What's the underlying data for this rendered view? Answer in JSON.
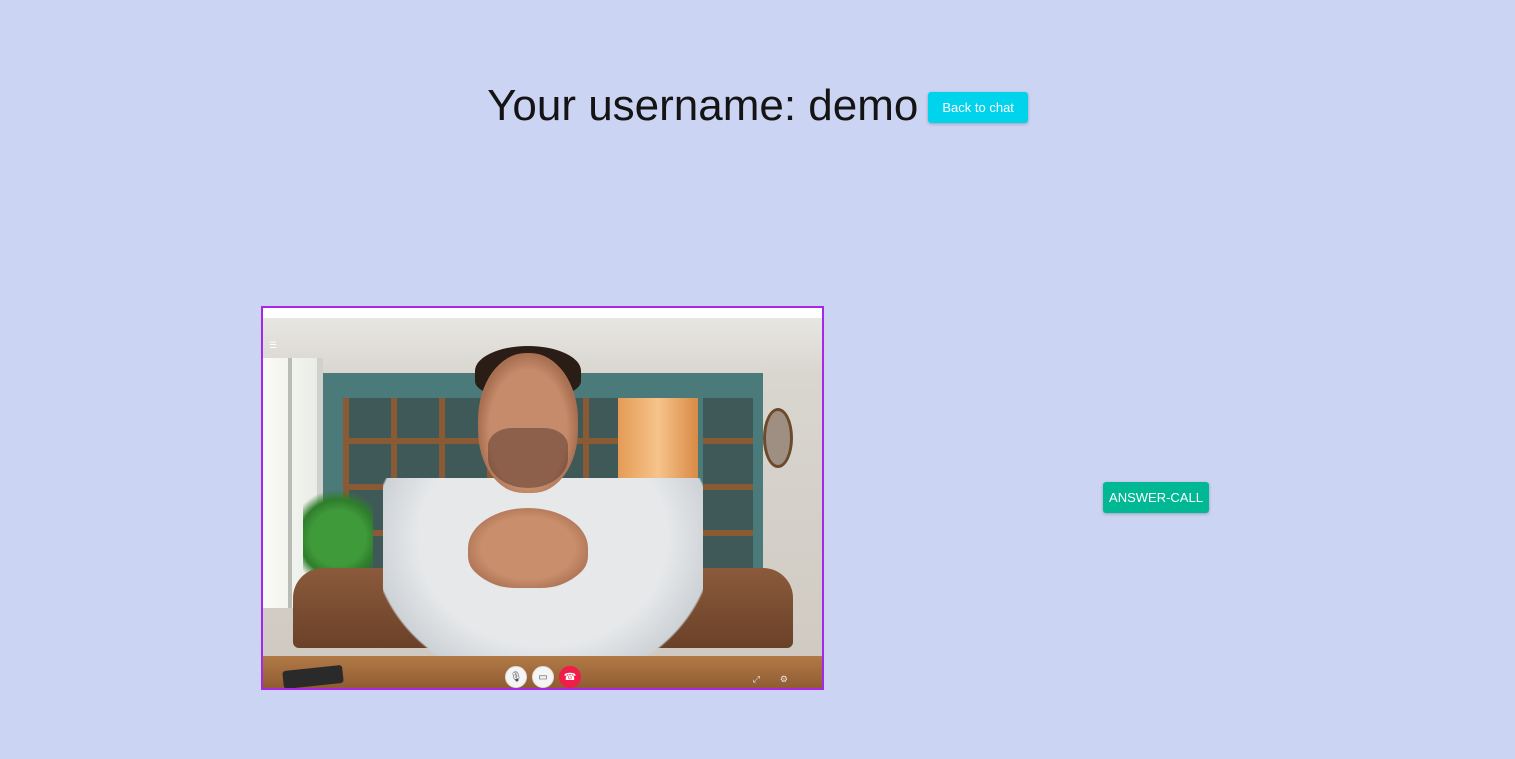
{
  "header": {
    "title": "Your username: demo",
    "back_button_label": "Back to chat"
  },
  "video": {
    "controls": [
      {
        "icon": "mic-icon"
      },
      {
        "icon": "camera-icon"
      },
      {
        "icon": "hangup-icon"
      }
    ]
  },
  "answer_button_label": "ANSWER-CALL",
  "colors": {
    "background": "#ccd4f3",
    "back_button": "#00d4ec",
    "answer_button": "#00b894",
    "video_border": "#a727e8",
    "hangup": "#ee1d4a"
  }
}
